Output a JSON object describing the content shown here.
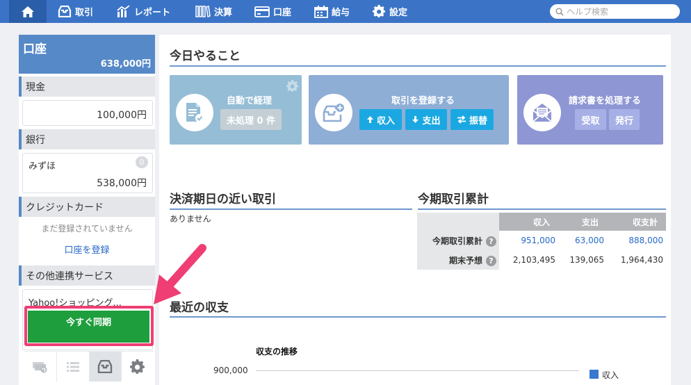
{
  "nav": {
    "items": [
      {
        "label": "取引",
        "icon": "inbox-icon"
      },
      {
        "label": "レポート",
        "icon": "bar-chart-icon"
      },
      {
        "label": "決算",
        "icon": "books-icon"
      },
      {
        "label": "口座",
        "icon": "credit-card-icon"
      },
      {
        "label": "給与",
        "icon": "calendar-icon"
      },
      {
        "label": "設定",
        "icon": "gear-icon"
      }
    ],
    "search_placeholder": "ヘルプ検索"
  },
  "sidebar": {
    "title": "口座",
    "total": "638,000円",
    "cash": {
      "header": "現金",
      "amount": "100,000円"
    },
    "bank": {
      "header": "銀行",
      "name": "みずほ",
      "badge": "0",
      "amount": "538,000円"
    },
    "credit": {
      "header": "クレジットカード",
      "note": "まだ登録されていません",
      "link": "口座を登録"
    },
    "services": {
      "header": "その他連携サービス",
      "name": "Yahoo!ショッピング...",
      "sync_label": "今すぐ同期"
    }
  },
  "main": {
    "todo_title": "今日やること",
    "cards": {
      "auto": {
        "title": "自動で経理",
        "pending": "未処理 0 件"
      },
      "register": {
        "title": "取引を登録する",
        "income": "収入",
        "expense": "支出",
        "transfer": "振替"
      },
      "invoice": {
        "title": "請求書を処理する",
        "receive": "受取",
        "issue": "発行"
      }
    },
    "due_title": "決済期日の近い取引",
    "due_empty": "ありません",
    "summary_title": "今期取引累計",
    "summary": {
      "headers": [
        "収入",
        "支出",
        "収支計"
      ],
      "rows": [
        {
          "label": "今期取引累計",
          "values": [
            "951,000",
            "63,000",
            "888,000"
          ]
        },
        {
          "label": "期末予想",
          "values": [
            "2,103,495",
            "139,065",
            "1,964,430"
          ]
        }
      ]
    },
    "recent_title": "最近の収支",
    "chart_title": "収支の推移",
    "chart_tick": "900,000",
    "chart_legend": "収入"
  },
  "colors": {
    "nav": "#3b74c7",
    "sync_button": "#1e9e3d",
    "highlight": "#ef3e74",
    "card_auto": "#95bdd6",
    "card_register": "#8faed6",
    "card_invoice": "#8e96d4",
    "action_button": "#1ba8e2"
  }
}
